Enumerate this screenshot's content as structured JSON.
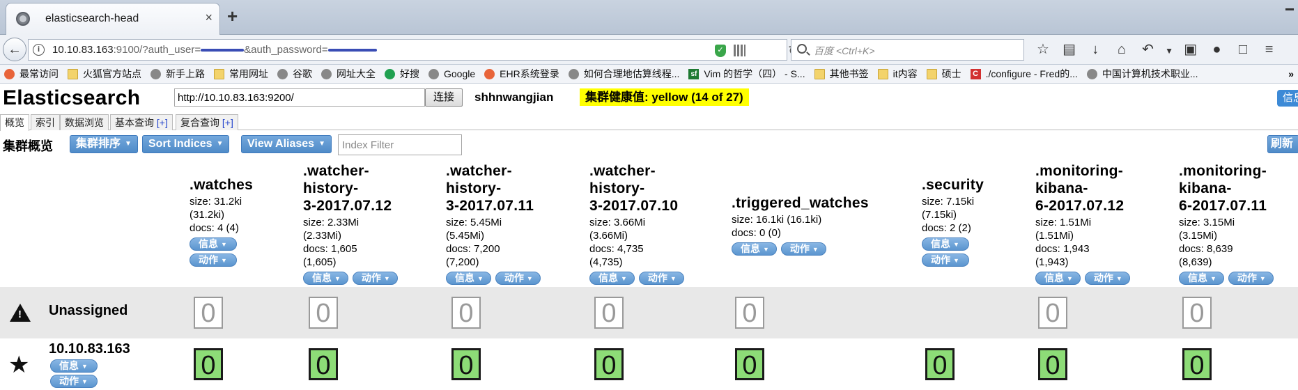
{
  "browser": {
    "tab_title": "elasticsearch-head",
    "tab_close": "×",
    "new_tab": "+",
    "url_prefix": "10.10.83.163",
    "url_port_query": ":9100/?auth_user=",
    "url_mid": "&auth_password=",
    "search_placeholder": "百度 <Ctrl+K>",
    "bookmarks": [
      {
        "label": "最常访问",
        "icon": "gear"
      },
      {
        "label": "火狐官方站点",
        "icon": "folder"
      },
      {
        "label": "新手上路",
        "icon": "globe"
      },
      {
        "label": "常用网址",
        "icon": "folder"
      },
      {
        "label": "谷歌",
        "icon": "globe"
      },
      {
        "label": "网址大全",
        "icon": "globe"
      },
      {
        "label": "好搜",
        "icon": "green"
      },
      {
        "label": "Google",
        "icon": "globe"
      },
      {
        "label": "EHR系统登录",
        "icon": "gear"
      },
      {
        "label": "如何合理地估算线程...",
        "icon": "globe"
      },
      {
        "label": "Vim 的哲学（四） - S...",
        "icon": "sf"
      },
      {
        "label": "其他书签",
        "icon": "folder"
      },
      {
        "label": "it内容",
        "icon": "folder"
      },
      {
        "label": "硕士",
        "icon": "folder"
      },
      {
        "label": "./configure - Fred的...",
        "icon": "red"
      },
      {
        "label": "中国计算机技术职业...",
        "icon": "globe"
      }
    ],
    "bookmarks_more": "»"
  },
  "app": {
    "title": "Elasticsearch",
    "connect_url": "http://10.10.83.163:9200/",
    "connect_button": "连接",
    "cluster_name": "shhnwangjian",
    "health": "集群健康值: yellow (14 of 27)",
    "info_button": "信息",
    "tabs": [
      {
        "label": "概览",
        "plus": ""
      },
      {
        "label": "索引",
        "plus": ""
      },
      {
        "label": "数据浏览",
        "plus": ""
      },
      {
        "label": "基本查询 ",
        "plus": "[+]"
      },
      {
        "label": "复合查询 ",
        "plus": "[+]"
      }
    ],
    "overview_label": "集群概览",
    "sort_cluster_button": "集群排序",
    "sort_indices_button": "Sort Indices",
    "view_aliases_button": "View Aliases",
    "index_filter_placeholder": "Index Filter",
    "refresh_button": "刷新",
    "info_pill": "信息",
    "action_pill": "动作",
    "indices": [
      {
        "name": ".watches",
        "size": "size: 31.2ki",
        "size2": "(31.2ki)",
        "docs": "docs: 4 (4)",
        "docs2": ""
      },
      {
        "name": ".watcher-\nhistory-\n3-2017.07.12",
        "size": "size: 2.33Mi",
        "size2": "(2.33Mi)",
        "docs": "docs: 1,605",
        "docs2": "(1,605)"
      },
      {
        "name": ".watcher-\nhistory-\n3-2017.07.11",
        "size": "size: 5.45Mi",
        "size2": "(5.45Mi)",
        "docs": "docs: 7,200",
        "docs2": "(7,200)"
      },
      {
        "name": ".watcher-\nhistory-\n3-2017.07.10",
        "size": "size: 3.66Mi",
        "size2": "(3.66Mi)",
        "docs": "docs: 4,735",
        "docs2": "(4,735)"
      },
      {
        "name": ".triggered_watches",
        "size": "size: 16.1ki (16.1ki)",
        "size2": "",
        "docs": "docs: 0 (0)",
        "docs2": ""
      },
      {
        "name": ".security",
        "size": "size: 7.15ki",
        "size2": "(7.15ki)",
        "docs": "docs: 2 (2)",
        "docs2": ""
      },
      {
        "name": ".monitoring-\nkibana-\n6-2017.07.12",
        "size": "size: 1.51Mi",
        "size2": "(1.51Mi)",
        "docs": "docs: 1,943",
        "docs2": "(1,943)"
      },
      {
        "name": ".monitoring-\nkibana-\n6-2017.07.11",
        "size": "size: 3.15Mi",
        "size2": "(3.15Mi)",
        "docs": "docs: 8,639",
        "docs2": "(8,639)"
      }
    ],
    "unassigned_label": "Unassigned",
    "node_name": "10.10.83.163",
    "shard_value": "0",
    "colors": {
      "health": "#ffff00",
      "button": "#4f8bc8",
      "shard_started": "#8ddc77"
    }
  }
}
